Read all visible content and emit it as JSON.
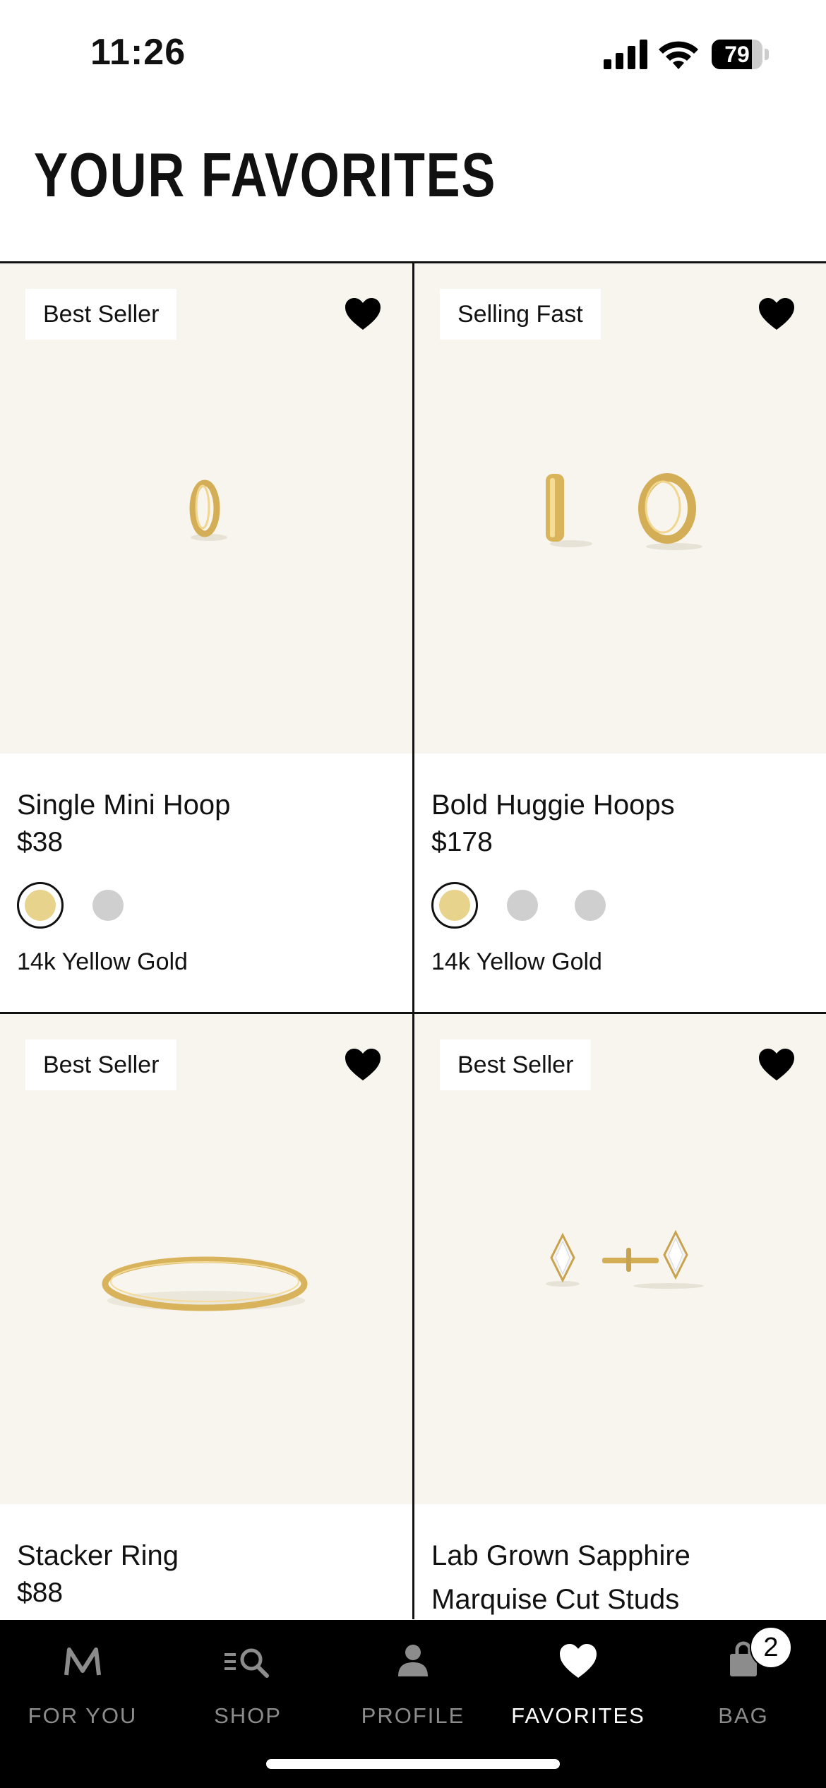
{
  "status_bar": {
    "time": "11:26",
    "battery": "79",
    "battery_level": 0.79
  },
  "page": {
    "title": "YOUR FAVORITES"
  },
  "products": [
    {
      "badge": "Best Seller",
      "name": "Single Mini Hoop",
      "price": "$38",
      "variant": "14k Yellow Gold",
      "swatches": [
        {
          "color": "#e8d38c",
          "selected": true
        },
        {
          "color": "#cfcfcf",
          "selected": false
        }
      ],
      "favorited": true
    },
    {
      "badge": "Selling Fast",
      "name": "Bold Huggie Hoops",
      "price": "$178",
      "variant": "14k Yellow Gold",
      "swatches": [
        {
          "color": "#e8d38c",
          "selected": true
        },
        {
          "color": "#cfcfcf",
          "selected": false
        },
        {
          "color": "#cfcfcf",
          "selected": false
        }
      ],
      "favorited": true
    },
    {
      "badge": "Best Seller",
      "name": "Stacker Ring",
      "price": "$88",
      "favorited": true
    },
    {
      "badge": "Best Seller",
      "name": "Lab Grown Sapphire Marquise Cut Studs",
      "favorited": true
    }
  ],
  "nav": {
    "items": [
      {
        "label": "FOR YOU",
        "icon": "monogram-m-icon"
      },
      {
        "label": "SHOP",
        "icon": "search-list-icon"
      },
      {
        "label": "PROFILE",
        "icon": "person-icon"
      },
      {
        "label": "FAVORITES",
        "icon": "heart-icon",
        "active": true
      },
      {
        "label": "BAG",
        "icon": "bag-icon"
      }
    ],
    "bag_count": "2"
  },
  "colors": {
    "image_bg": "#f8f5ee",
    "nav_bg": "#000000",
    "gold": "#e8d38c",
    "silver": "#cfcfcf"
  }
}
